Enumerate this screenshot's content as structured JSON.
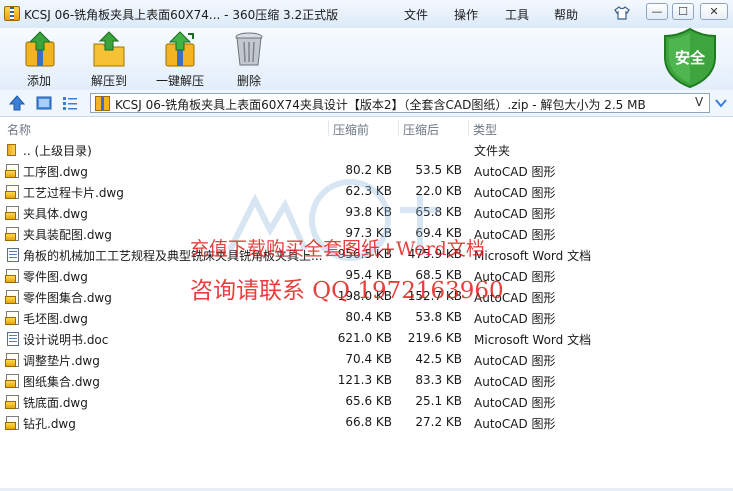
{
  "window": {
    "title": "KCSJ 06-铣角板夹具上表面60X74... - 360压缩 3.2正式版",
    "menu": [
      "文件",
      "操作",
      "工具",
      "帮助"
    ],
    "controls": {
      "minimize": "—",
      "maximize": "☐",
      "close": "✕"
    }
  },
  "toolbar": {
    "items": [
      {
        "label": "添加",
        "icon": "add-archive-icon"
      },
      {
        "label": "解压到",
        "icon": "extract-to-icon"
      },
      {
        "label": "一键解压",
        "icon": "one-click-extract-icon"
      },
      {
        "label": "删除",
        "icon": "trash-can-icon"
      }
    ],
    "security_label": "安全"
  },
  "address": {
    "path": "KCSJ 06-铣角板夹具上表面60X74夹具设计【版本2】（全套含CAD图纸）.zip - 解包大小为 2.5 MB"
  },
  "columns": {
    "name": "名称",
    "before": "压缩前",
    "after": "压缩后",
    "type": "类型"
  },
  "files": [
    {
      "name": ".. (上级目录)",
      "before": "",
      "after": "",
      "type": "文件夹",
      "icon": "folder"
    },
    {
      "name": "工序图.dwg",
      "before": "80.2 KB",
      "after": "53.5 KB",
      "type": "AutoCAD 图形",
      "icon": "dwg"
    },
    {
      "name": "工艺过程卡片.dwg",
      "before": "62.3 KB",
      "after": "22.0 KB",
      "type": "AutoCAD 图形",
      "icon": "dwg"
    },
    {
      "name": "夹具体.dwg",
      "before": "93.8 KB",
      "after": "65.8 KB",
      "type": "AutoCAD 图形",
      "icon": "dwg"
    },
    {
      "name": "夹具装配图.dwg",
      "before": "97.3 KB",
      "after": "69.4 KB",
      "type": "AutoCAD 图形",
      "icon": "dwg"
    },
    {
      "name": "角板的机械加工工艺规程及典型铣床夹具铣角板夹具上...",
      "before": "956.5 KB",
      "after": "475.9 KB",
      "type": "Microsoft Word 文档",
      "icon": "doc"
    },
    {
      "name": "零件图.dwg",
      "before": "95.4 KB",
      "after": "68.5 KB",
      "type": "AutoCAD 图形",
      "icon": "dwg"
    },
    {
      "name": "零件图集合.dwg",
      "before": "198.0 KB",
      "after": "152.7 KB",
      "type": "AutoCAD 图形",
      "icon": "dwg"
    },
    {
      "name": "毛坯图.dwg",
      "before": "80.4 KB",
      "after": "53.8 KB",
      "type": "AutoCAD 图形",
      "icon": "dwg"
    },
    {
      "name": "设计说明书.doc",
      "before": "621.0 KB",
      "after": "219.6 KB",
      "type": "Microsoft Word 文档",
      "icon": "doc"
    },
    {
      "name": "调整垫片.dwg",
      "before": "70.4 KB",
      "after": "42.5 KB",
      "type": "AutoCAD 图形",
      "icon": "dwg"
    },
    {
      "name": "图纸集合.dwg",
      "before": "121.3 KB",
      "after": "83.3 KB",
      "type": "AutoCAD 图形",
      "icon": "dwg"
    },
    {
      "name": "铣底面.dwg",
      "before": "65.6 KB",
      "after": "25.1 KB",
      "type": "AutoCAD 图形",
      "icon": "dwg"
    },
    {
      "name": "钻孔.dwg",
      "before": "66.8 KB",
      "after": "27.2 KB",
      "type": "AutoCAD 图形",
      "icon": "dwg"
    }
  ],
  "watermark": {
    "line1": "充值下载购买全套图纸+Word文档",
    "line2": "咨询请联系  QQ 1972163960"
  }
}
